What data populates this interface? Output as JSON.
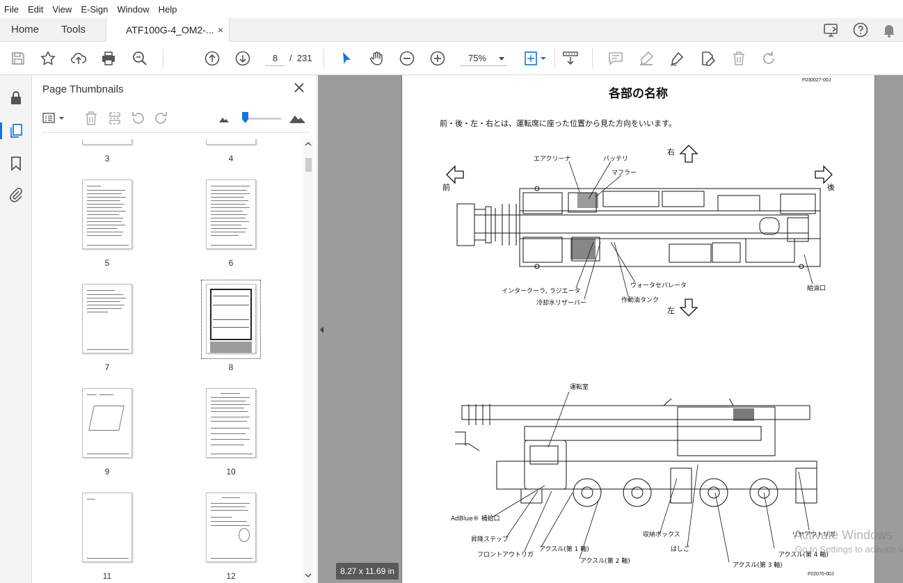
{
  "menu": [
    "File",
    "Edit",
    "View",
    "E-Sign",
    "Window",
    "Help"
  ],
  "tabs": {
    "home": "Home",
    "tools": "Tools",
    "document": "ATF100G-4_OM2-...",
    "close": "×"
  },
  "toolbar": {
    "current_page": "8",
    "page_separator": "/",
    "total_pages": "231",
    "zoom": "75%"
  },
  "thumbnails": {
    "title": "Page Thumbnails",
    "pages": [
      {
        "label": "3"
      },
      {
        "label": "4"
      },
      {
        "label": "5"
      },
      {
        "label": "6"
      },
      {
        "label": "7"
      },
      {
        "label": "8",
        "selected": true
      },
      {
        "label": "9"
      },
      {
        "label": "10"
      },
      {
        "label": "11"
      },
      {
        "label": "12"
      }
    ]
  },
  "page_size": "8.27 x 11.69 in",
  "document": {
    "code_top": "F030027-00J",
    "title": "各部の名称",
    "intro": "前・後・左・右とは、運転席に座った位置から見た方向をいいます。",
    "directions": {
      "right": "右",
      "front": "前",
      "rear": "後",
      "left": "左"
    },
    "top_view_labels": {
      "air_cleaner": "エアクリーナ",
      "battery": "バッテリ",
      "muffler": "マフラー",
      "intercooler": "インタークーラ, ラジエータ",
      "coolant": "冷却水リザーバー",
      "water_separator": "ウォータセパレータ",
      "hydraulic_tank": "作動油タンク",
      "fuel_inlet": "給油口"
    },
    "side_view_labels": {
      "cab": "運転室",
      "adblue": "AdBlue® 補給口",
      "step": "昇降ステップ",
      "front_outrigger": "フロントアウトリガ",
      "axle1": "アクスル(第 1 軸)",
      "axle2": "アクスル(第 2 軸)",
      "storage": "収納ボックス",
      "ladder": "はしご",
      "axle3": "アクスル(第 3 軸)",
      "axle4": "アクスル(第 4 軸)",
      "rear_outrigger": "リヤアウトリガ"
    },
    "code_bottom": "F02070-00J"
  },
  "watermark": {
    "line1": "Activate Windows",
    "line2": "Go to Settings to activate Windows."
  },
  "colors": {
    "accent": "#1473e6",
    "doc_background": "#9c9c9c"
  }
}
